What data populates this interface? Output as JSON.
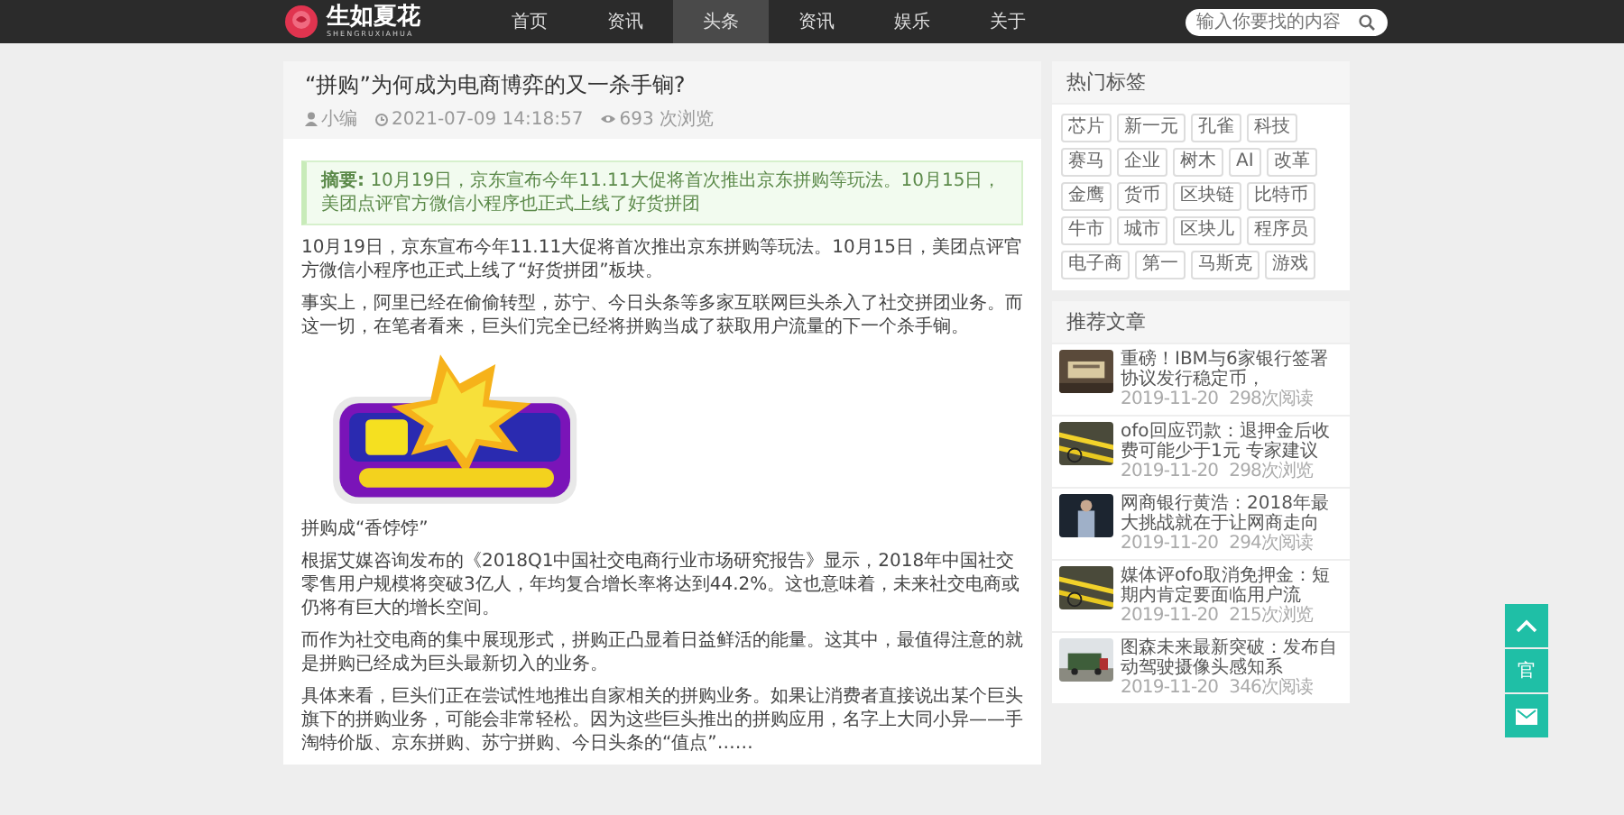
{
  "header": {
    "logo": {
      "title": "生如夏花",
      "subtitle": "SHENGRUXIAHUA"
    },
    "nav": [
      {
        "label": "首页",
        "selected": false
      },
      {
        "label": "资讯",
        "selected": false
      },
      {
        "label": "头条",
        "selected": true
      },
      {
        "label": "资讯",
        "selected": false
      },
      {
        "label": "娱乐",
        "selected": false
      },
      {
        "label": "关于",
        "selected": false
      }
    ],
    "search": {
      "placeholder": "输入你要找的内容"
    }
  },
  "article": {
    "title": "“拼购”为何成为电商博弈的又一杀手锏?",
    "author": "小编",
    "date": "2021-07-09 14:18:57",
    "views": "693 次浏览",
    "summary_label": "摘要:",
    "summary": "10月19日，京东宣布今年11.11大促将首次推出京东拼购等玩法。10月15日，美团点评官方微信小程序也正式上线了好货拼团",
    "paragraphs_top": [
      "10月19日，京东宣布今年11.11大促将首次推出京东拼购等玩法。10月15日，美团点评官方微信小程序也正式上线了“好货拼团”板块。",
      "事实上，阿里已经在偷偷转型，苏宁、今日头条等多家互联网巨头杀入了社交拼团业务。而这一切，在笔者看来，巨头们完全已经将拼购当成了获取用户流量的下一个杀手锏。"
    ],
    "caption": "拼购成“香饽饽”",
    "paragraphs_bottom": [
      "根据艾媒咨询发布的《2018Q1中国社交电商行业市场研究报告》显示，2018年中国社交零售用户规模将突破3亿人，年均复合增长率将达到44.2%。这也意味着，未来社交电商或仍将有巨大的增长空间。",
      "而作为社交电商的集中展现形式，拼购正凸显着日益鲜活的能量。这其中，最值得注意的就是拼购已经成为巨头最新切入的业务。",
      "具体来看，巨头们正在尝试性地推出自家相关的拼购业务。如果让消费者直接说出某个巨头旗下的拼购业务，可能会非常轻松。因为这些巨头推出的拼购应用，名字上大同小异——手淘特价版、京东拼购、苏宁拼购、今日头条的“值点”……"
    ]
  },
  "hot_tags": {
    "title": "热门标签",
    "tags": [
      "芯片",
      "新一元",
      "孔雀",
      "科技",
      "赛马",
      "企业",
      "树木",
      "AI",
      "改革",
      "金鹰",
      "货币",
      "区块链",
      "比特币",
      "牛市",
      "城市",
      "区块儿",
      "程序员",
      "电子商",
      "第一",
      "马斯克",
      "游戏"
    ]
  },
  "recommended": {
    "title": "推荐文章",
    "items": [
      {
        "title": "重磅！IBM与6家银行签署协议发行稳定币，",
        "date": "2019-11-20",
        "views": "298次阅读"
      },
      {
        "title": "ofo回应罚款：退押金后收费可能少于1元 专家建议",
        "date": "2019-11-20",
        "views": "298次浏览"
      },
      {
        "title": "网商银行黄浩：2018年最大挑战就在于让网商走向",
        "date": "2019-11-20",
        "views": "294次阅读"
      },
      {
        "title": "媒体评ofo取消免押金：短期内肯定要面临用户流",
        "date": "2019-11-20",
        "views": "215次浏览"
      },
      {
        "title": "图森未来最新突破：发布自动驾驶摄像头感知系",
        "date": "2019-11-20",
        "views": "346次阅读"
      }
    ]
  },
  "float_buttons": [
    {
      "kind": "top"
    },
    {
      "kind": "text",
      "label": "官"
    },
    {
      "kind": "mail"
    }
  ]
}
